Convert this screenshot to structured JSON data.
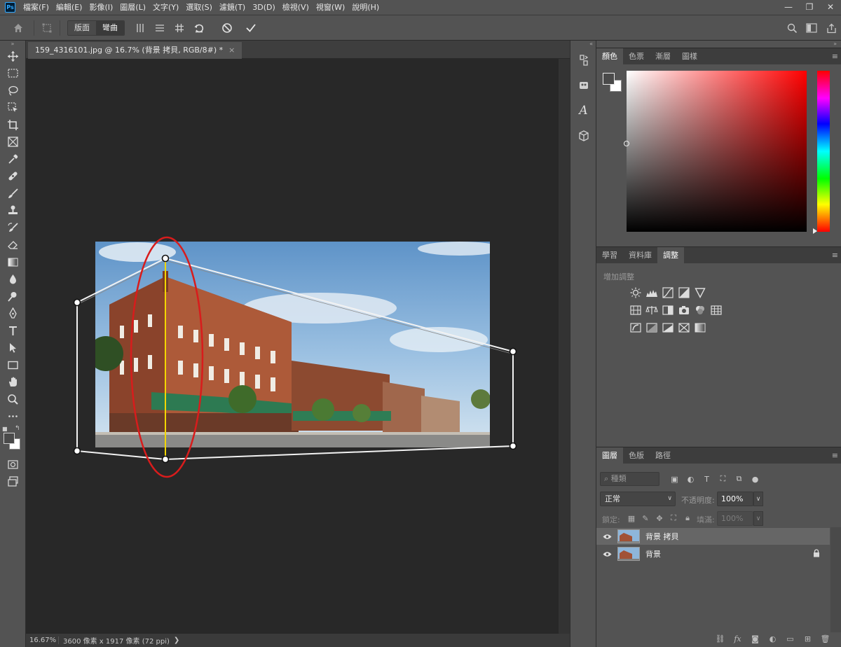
{
  "app": {
    "logo": "Ps",
    "menu": [
      "檔案(F)",
      "編輯(E)",
      "影像(I)",
      "圖層(L)",
      "文字(Y)",
      "選取(S)",
      "濾鏡(T)",
      "3D(D)",
      "檢視(V)",
      "視窗(W)",
      "說明(H)"
    ],
    "window_controls": [
      "—",
      "❐",
      "✕"
    ]
  },
  "options_bar": {
    "mode_buttons": [
      "版面",
      "彎曲"
    ],
    "active_mode": "彎曲"
  },
  "document": {
    "tab_title": "159_4316101.jpg @ 16.7% (背景 拷貝, RGB/8#) *",
    "tab_close": "×",
    "zoom": "16.67%",
    "info": "3600 像素 x 1917 像素 (72 ppi)",
    "info_arrow": "❯"
  },
  "panels": {
    "color_tabs": [
      "顏色",
      "色票",
      "漸層",
      "圖樣"
    ],
    "color_active": "顏色",
    "adjust_tabs": [
      "學習",
      "資料庫",
      "調整"
    ],
    "adjust_active": "調整",
    "adjust_heading": "增加調整",
    "layers_tabs": [
      "圖層",
      "色版",
      "路徑"
    ],
    "layers_active": "圖層",
    "menu_icon": "≡"
  },
  "layers": {
    "filter_kind": "種類",
    "blend_mode": "正常",
    "opacity_label": "不透明度:",
    "opacity": "100%",
    "lock_label": "鎖定:",
    "fill_label": "填滿:",
    "fill": "100%",
    "items": [
      {
        "name": "背景 拷貝",
        "selected": true,
        "locked": false
      },
      {
        "name": "背景",
        "selected": false,
        "locked": true
      }
    ]
  },
  "colors": {
    "foreground": "#4a4a4a",
    "background": "#ffffff",
    "accent_marker": "#d81c1c",
    "warp_line": "#f2d600"
  }
}
